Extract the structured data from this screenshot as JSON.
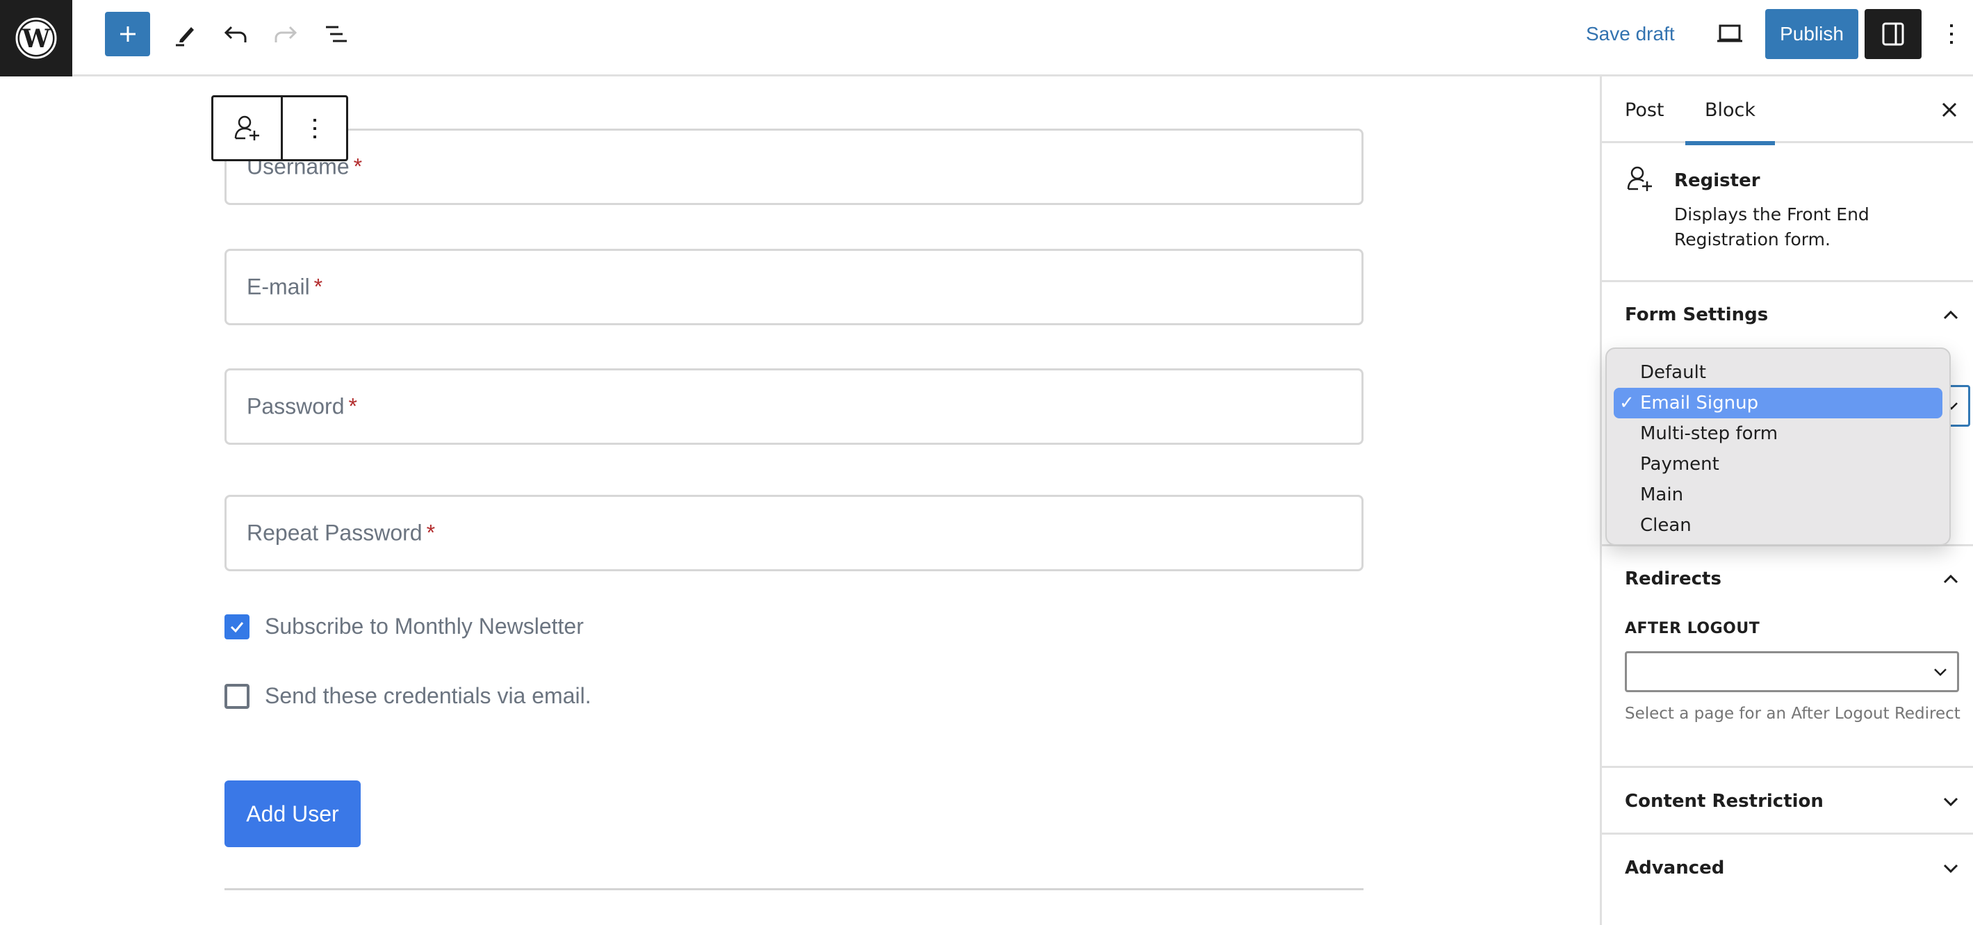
{
  "header": {
    "logo": "wordpress-logo",
    "inserter_icon": "plus-icon",
    "tools_icon": "pencil-icon",
    "undo_icon": "undo-icon",
    "redo_icon": "redo-icon",
    "list_view_icon": "list-view-icon",
    "save_draft_label": "Save draft",
    "preview_icon": "laptop-icon",
    "publish_label": "Publish",
    "settings_icon": "sidebar-toggle-icon",
    "options_icon": "kebab-icon"
  },
  "block_toolbar": {
    "block_icon": "user-add-icon",
    "options_icon": "kebab-icon"
  },
  "form": {
    "fields": [
      {
        "label": "Username",
        "required": "*"
      },
      {
        "label": "E-mail",
        "required": "*"
      },
      {
        "label": "Password",
        "required": "*"
      },
      {
        "label": "Repeat Password",
        "required": "*"
      }
    ],
    "checkboxes": [
      {
        "label": "Subscribe to Monthly Newsletter",
        "checked": true
      },
      {
        "label": "Send these credentials via email.",
        "checked": false
      }
    ],
    "submit_label": "Add User"
  },
  "sidebar": {
    "tabs": [
      {
        "label": "Post",
        "active": false
      },
      {
        "label": "Block",
        "active": true
      }
    ],
    "close_icon": "close-icon",
    "block_card": {
      "icon": "user-add-icon",
      "title": "Register",
      "description": "Displays the Front End Registration form."
    },
    "panels": {
      "form_settings": {
        "title": "Form Settings",
        "expanded": true
      },
      "redirects": {
        "title": "Redirects",
        "expanded": true,
        "after_logout_label": "AFTER LOGOUT",
        "after_logout_value": "",
        "after_logout_help": "Select a page for an After Logout Redirect"
      },
      "content_restriction": {
        "title": "Content Restriction",
        "expanded": false
      },
      "advanced": {
        "title": "Advanced",
        "expanded": false
      }
    },
    "form_dropdown": {
      "selected": "Email Signup",
      "options": [
        "Default",
        "Email Signup",
        "Multi-step form",
        "Payment",
        "Main",
        "Clean"
      ]
    }
  },
  "colors": {
    "wp_blue": "#3379b6",
    "form_blue": "#3a78e7",
    "required_red": "#b32d2e",
    "selected_option": "#6699f2"
  }
}
